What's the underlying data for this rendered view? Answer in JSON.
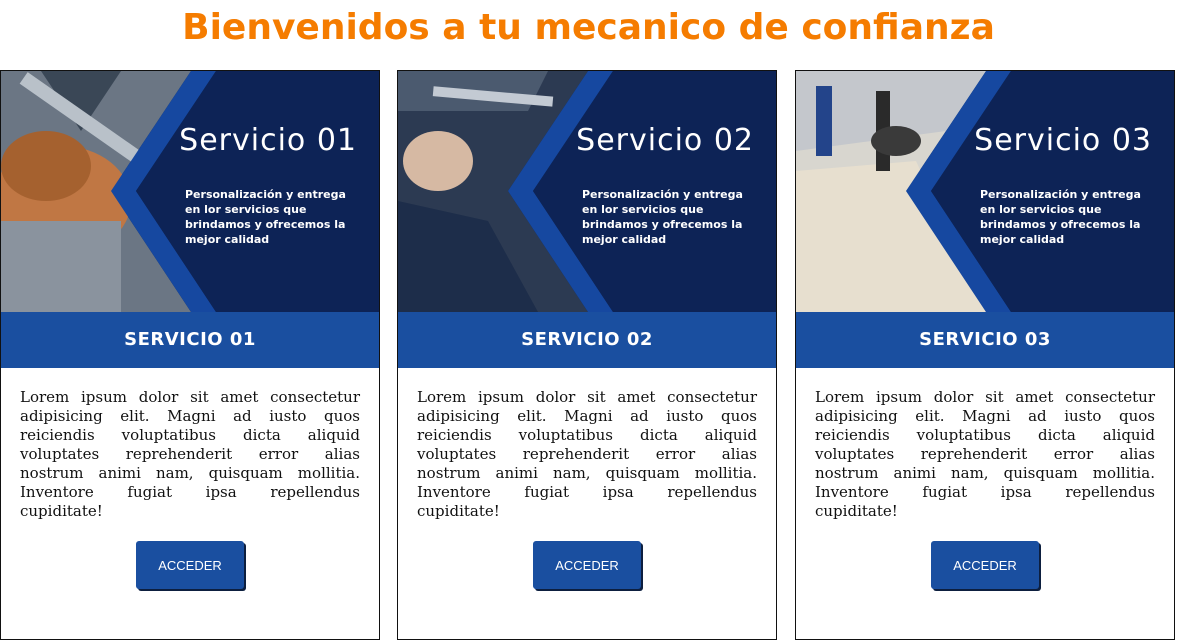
{
  "page": {
    "title": "Bienvenidos a tu mecanico de confianza"
  },
  "colors": {
    "title": "#f57c00",
    "primary": "#1a4fa0",
    "banner_dark": "#0b1d45"
  },
  "cards": [
    {
      "banner_title": "Servicio 01",
      "banner_subtitle": "Personalización y entrega en lor servicios que brindamos y ofrecemos la mejor calidad",
      "header": "SERVICIO 01",
      "text": "Lorem ipsum dolor sit amet consectetur adipisicing elit. Magni ad iusto quos reiciendis voluptatibus dicta aliquid voluptates reprehenderit error alias nostrum animi nam, quisquam mollitia. Inventore fugiat ipsa repellendus cupiditate!",
      "button": "ACCEDER",
      "image": "mechanic-hand-wrench"
    },
    {
      "banner_title": "Servicio 02",
      "banner_subtitle": "Personalización y entrega en lor servicios que brindamos y ofrecemos la mejor calidad",
      "header": "SERVICIO 02",
      "text": "Lorem ipsum dolor sit amet consectetur adipisicing elit. Magni ad iusto quos reiciendis voluptatibus dicta aliquid voluptates reprehenderit error alias nostrum animi nam, quisquam mollitia. Inventore fugiat ipsa repellendus cupiditate!",
      "button": "ACCEDER",
      "image": "mechanic-under-car"
    },
    {
      "banner_title": "Servicio 03",
      "banner_subtitle": "Personalización y entrega en lor servicios que brindamos y ofrecemos la mejor calidad",
      "header": "SERVICIO 03",
      "text": "Lorem ipsum dolor sit amet consectetur adipisicing elit. Magni ad iusto quos reiciendis voluptatibus dicta aliquid voluptates reprehenderit error alias nostrum animi nam, quisquam mollitia. Inventore fugiat ipsa repellendus cupiditate!",
      "button": "ACCEDER",
      "image": "auto-workshop-floor"
    }
  ]
}
